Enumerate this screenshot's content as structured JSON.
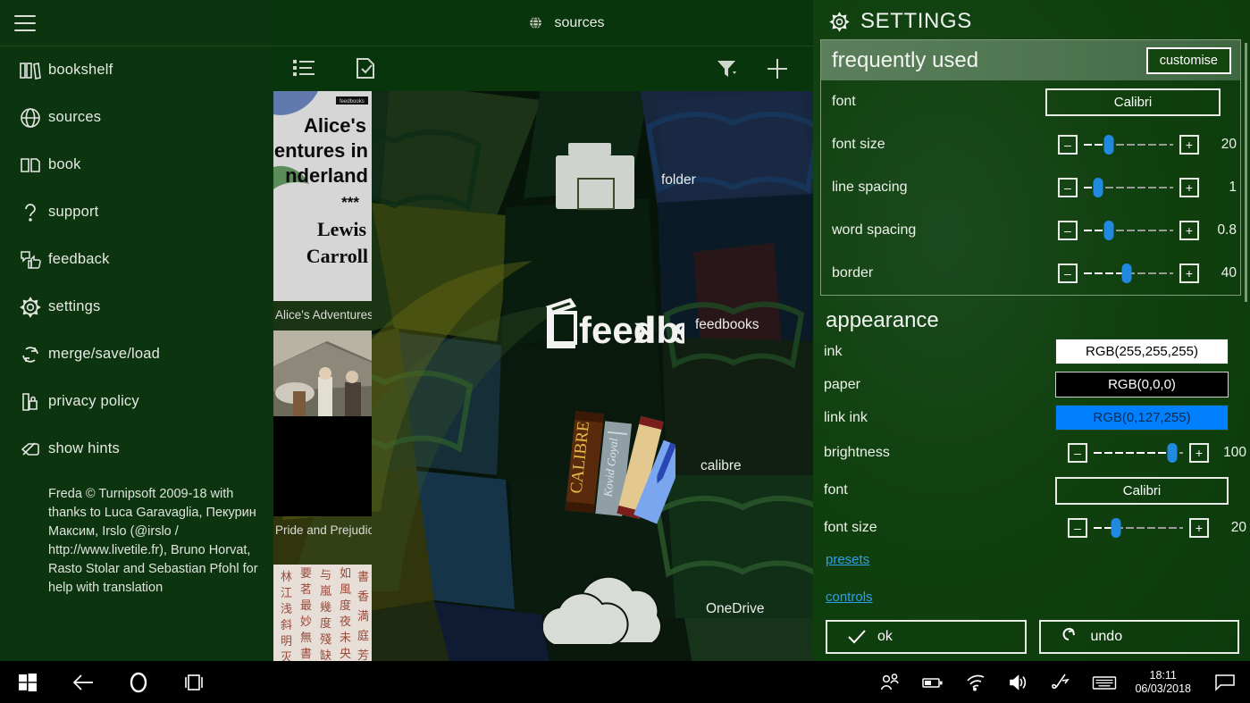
{
  "sidebar": {
    "menu_icon": "hamburger-icon",
    "items": [
      {
        "label": "bookshelf",
        "icon": "books-icon"
      },
      {
        "label": "sources",
        "icon": "globe-icon"
      },
      {
        "label": "book",
        "icon": "book-pages-icon"
      },
      {
        "label": "support",
        "icon": "question-mark-icon"
      },
      {
        "label": "feedback",
        "icon": "thumbs-feedback-icon"
      },
      {
        "label": "settings",
        "icon": "gear-icon"
      },
      {
        "label": "merge/save/load",
        "icon": "refresh-icon"
      },
      {
        "label": "privacy policy",
        "icon": "lock-document-icon"
      },
      {
        "label": "show hints",
        "icon": "tag-icon"
      }
    ],
    "credits": "Freda © Turnipsoft 2009-18 with thanks to Luca Garavaglia, Пекурин Максим, Irslo (@irslo / http://www.livetile.fr), Bruno Horvat, Rasto Stolar and Sebastian Pfohl for help with translation"
  },
  "header": {
    "title": "sources",
    "title_icon": "globe-icon",
    "toolbar": [
      {
        "name": "list-view-button",
        "icon": "list-icon"
      },
      {
        "name": "select-button",
        "icon": "checked-document-icon"
      },
      {
        "name": "filter-button",
        "icon": "funnel-icon"
      },
      {
        "name": "add-button",
        "icon": "plus-icon"
      }
    ]
  },
  "sources": [
    {
      "label": "folder",
      "icon": "folder-icon"
    },
    {
      "label": "feedbooks",
      "icon": "feedbooks-logo"
    },
    {
      "label": "calibre",
      "icon": "calibre-books-icon"
    },
    {
      "label": "OneDrive",
      "icon": "onedrive-cloud-icon"
    }
  ],
  "covers": [
    {
      "title_lines": [
        "Alice's",
        "Adventures in",
        "Wonderland",
        "***",
        "Lewis",
        "Carroll"
      ],
      "caption": "Alice's Adventures in Wo",
      "badge": "feedbooks"
    },
    {
      "caption": "Pride and Prejudice"
    },
    {
      "caption": ""
    }
  ],
  "settings": {
    "panel_title": "SETTINGS",
    "panel_icon": "gear-icon",
    "frequently_used": {
      "heading": "frequently used",
      "customise_label": "customise",
      "rows": [
        {
          "label": "font",
          "type": "pill",
          "value": "Calibri"
        },
        {
          "label": "font size",
          "type": "slider",
          "value": "20",
          "percent": 28
        },
        {
          "label": "line spacing",
          "type": "slider",
          "value": "1",
          "percent": 16
        },
        {
          "label": "word spacing",
          "type": "slider",
          "value": "0.8",
          "percent": 28
        },
        {
          "label": "border",
          "type": "slider",
          "value": "40",
          "percent": 48
        }
      ]
    },
    "appearance": {
      "heading": "appearance",
      "rows": [
        {
          "label": "ink",
          "type": "swatch",
          "value": "RGB(255,255,255)",
          "bg": "#ffffff",
          "fg": "#000000"
        },
        {
          "label": "paper",
          "type": "swatch",
          "value": "RGB(0,0,0)",
          "bg": "#000000",
          "fg": "#ffffff"
        },
        {
          "label": "link ink",
          "type": "swatch",
          "value": "RGB(0,127,255)",
          "bg": "#007fff",
          "fg": "#0b2b4d"
        },
        {
          "label": "brightness",
          "type": "slider",
          "value": "100",
          "percent": 88
        },
        {
          "label": "font",
          "type": "pill",
          "value": "Calibri"
        },
        {
          "label": "font size",
          "type": "slider",
          "value": "20",
          "percent": 25
        }
      ]
    },
    "links": [
      {
        "label": "presets",
        "name": "presets-link"
      },
      {
        "label": "controls",
        "name": "controls-link"
      }
    ],
    "buttons": [
      {
        "label": "ok",
        "icon": "check-icon",
        "name": "ok-button"
      },
      {
        "label": "undo",
        "icon": "undo-arrow-icon",
        "name": "undo-button"
      }
    ]
  },
  "colors": {
    "accent_blue": "#1f8ae0",
    "link_blue": "#2f9fe8",
    "sidebar_bg": "#0c340f",
    "panel_bg": "#11400f",
    "header_bg": "#08350b"
  },
  "taskbar": {
    "left": [
      {
        "name": "start-button",
        "icon": "windows-logo-icon"
      },
      {
        "name": "back-button",
        "icon": "back-arrow-icon"
      },
      {
        "name": "cortana-button",
        "icon": "circle-icon"
      },
      {
        "name": "task-view-button",
        "icon": "task-view-icon"
      }
    ],
    "right": [
      {
        "name": "people-button",
        "icon": "people-icon"
      },
      {
        "name": "battery-button",
        "icon": "battery-icon"
      },
      {
        "name": "wifi-button",
        "icon": "wifi-icon"
      },
      {
        "name": "volume-button",
        "icon": "speaker-icon"
      },
      {
        "name": "pen-button",
        "icon": "pen-icon"
      },
      {
        "name": "keyboard-button",
        "icon": "keyboard-icon"
      }
    ],
    "time": "18:11",
    "date": "06/03/2018",
    "notifications_icon": "notification-icon"
  }
}
